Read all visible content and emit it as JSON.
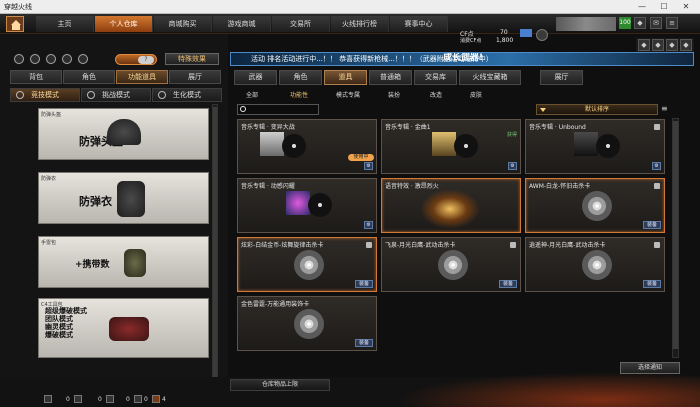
{
  "window": {
    "title": "穿越火线",
    "minimize": "—",
    "maximize": "☐",
    "close": "✕"
  },
  "topnav": {
    "items": [
      "主页",
      "个人仓库",
      "商城购买",
      "游戏商城",
      "交易所",
      "火线排行榜",
      "赛事中心"
    ],
    "active_index": 1
  },
  "resources": {
    "cf_label": "CF点",
    "cf_value": "70",
    "cfp_label": "消费CF点",
    "cfp_value": "1,800",
    "level": "100"
  },
  "left": {
    "special_effects": "特殊效果",
    "main_tabs": [
      "背包",
      "角色",
      "功能道具",
      "展厅"
    ],
    "active_main": 2,
    "sub_tabs": [
      "竞技模式",
      "挑战模式",
      "生化模式"
    ],
    "active_sub": 0,
    "categories": [
      {
        "caption": "防弹头盔",
        "label": "防弹头盔"
      },
      {
        "caption": "防弹衣",
        "label": "防弹衣"
      },
      {
        "caption": "手雷包",
        "label": "+携带数"
      },
      {
        "caption": "C4工具包",
        "label": "超级爆破模式\n团队模式\n幽灵模式\n爆破模式"
      }
    ]
  },
  "right": {
    "banner": "活动 排名活动进行中...！！ 恭喜获得新枪械...！！！（武器附送活动进行中）",
    "promo": "成长武器!",
    "tabs": [
      "武器",
      "角色",
      "道具",
      "普通箱",
      "交易库",
      "火线宝藏箱",
      "展厅"
    ],
    "active_tab": 2,
    "subtabs": [
      "全部",
      "功能性",
      "模式专属",
      "装扮",
      "改造",
      "皮肤"
    ],
    "active_subtab": 1,
    "search": {
      "placeholder": ""
    },
    "sort_label": "默认排序",
    "cards": [
      {
        "name": "音乐专辑 · 变异大战",
        "badge": "",
        "action": "使用中",
        "lock": false
      },
      {
        "name": "音乐专辑 · 金曲1",
        "badge": "获得",
        "action": "",
        "lock": false
      },
      {
        "name": "音乐专辑 · Unbound",
        "badge": "",
        "action": "",
        "lock": true
      },
      {
        "name": "音乐专辑 · 动感闪耀",
        "badge": "",
        "action": "",
        "lock": false
      },
      {
        "name": "语音特效 · 激昂烈火",
        "badge": "",
        "action": "",
        "lock": false
      },
      {
        "name": "AWM-白龙-怀旧击杀卡",
        "badge": "",
        "action": "装备",
        "lock": true
      },
      {
        "name": "炫彩-白结金币-炫舞旋律击杀卡",
        "badge": "",
        "action": "装备",
        "lock": true
      },
      {
        "name": "飞泉-月光白鹰-武动击杀卡",
        "badge": "",
        "action": "装备",
        "lock": true
      },
      {
        "name": "逍遥神-月光白鹰-武动击杀卡",
        "badge": "",
        "action": "装备",
        "lock": true
      },
      {
        "name": "金色雷霆-万能通用装饰卡",
        "badge": "",
        "action": "装备",
        "lock": false
      }
    ],
    "select_label": "选择通知"
  },
  "bottom": {
    "warehouse_label": "仓库物品上限",
    "counts": [
      "0",
      "0",
      "0",
      "0",
      "4"
    ]
  }
}
